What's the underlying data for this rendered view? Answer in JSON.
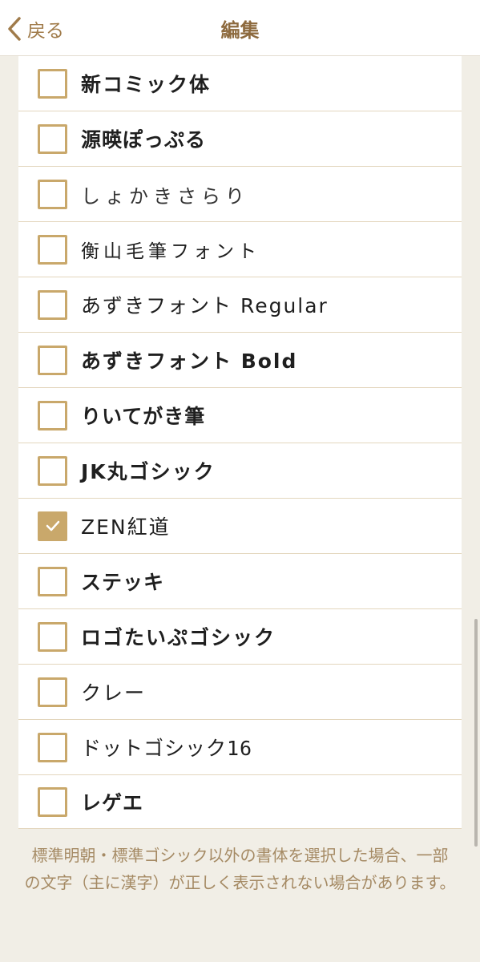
{
  "nav": {
    "back_label": "戻る",
    "title": "編集"
  },
  "fonts": [
    {
      "label": "新コミック体",
      "checked": false,
      "style": "bold"
    },
    {
      "label": "源暎ぽっぷる",
      "checked": false,
      "style": "heavy"
    },
    {
      "label": "しょかきさらり",
      "checked": false,
      "style": "thin"
    },
    {
      "label": "衡山毛筆フォント",
      "checked": false,
      "style": "brush"
    },
    {
      "label": "あずきフォント Regular",
      "checked": false,
      "style": "normal"
    },
    {
      "label": "あずきフォント Bold",
      "checked": false,
      "style": "bold"
    },
    {
      "label": "りいてがき筆",
      "checked": false,
      "style": "heavy"
    },
    {
      "label": "JK丸ゴシック",
      "checked": false,
      "style": "bold"
    },
    {
      "label": "ZEN紅道",
      "checked": true,
      "style": "normal"
    },
    {
      "label": "ステッキ",
      "checked": false,
      "style": "heavy"
    },
    {
      "label": "ロゴたいぷゴシック",
      "checked": false,
      "style": "bold"
    },
    {
      "label": "クレー",
      "checked": false,
      "style": "normal"
    },
    {
      "label": "ドットゴシック16",
      "checked": false,
      "style": "mono"
    },
    {
      "label": "レゲエ",
      "checked": false,
      "style": "heavy"
    }
  ],
  "footnote": "標準明朝・標準ゴシック以外の書体を選択した場合、一部の文字（主に漢字）が正しく表示されない場合があります。",
  "colors": {
    "accent": "#c9a86b",
    "title": "#8d6a3e",
    "background": "#f1eee6"
  }
}
